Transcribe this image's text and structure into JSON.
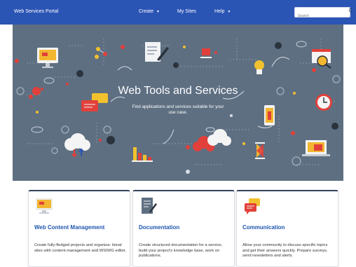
{
  "navbar": {
    "brand": "Web Services Portal",
    "items": [
      {
        "label": "Create",
        "has_dropdown": true
      },
      {
        "label": "My Sites",
        "has_dropdown": false
      },
      {
        "label": "Help",
        "has_dropdown": true
      }
    ],
    "search_placeholder": "Search",
    "search_icon": "search-icon",
    "color": "#2b55b5"
  },
  "hero": {
    "title": "Web Tools and Services",
    "subtitle": "Find applications and services suitable for your use case.",
    "background": "#5e6f82"
  },
  "cards": [
    {
      "icon": "monitor-icon",
      "title": "Web Content Management",
      "description": "Create fully-fledged projects and organiza- tional sites with content management and WSIWG editor."
    },
    {
      "icon": "document-pen-icon",
      "title": "Documentation",
      "description": "Create structured documentation for a service, build your project's knowledge base, work on publications."
    },
    {
      "icon": "chat-bubbles-icon",
      "title": "Communication",
      "description": "Allow your community to discuss specific topics and get their answers quickly. Prepare surveys, send newsletters and alerts."
    }
  ]
}
